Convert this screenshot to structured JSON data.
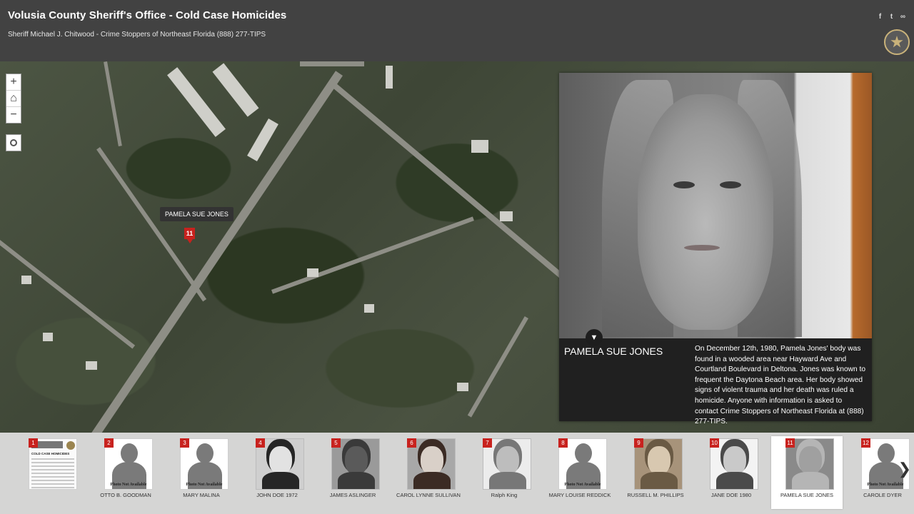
{
  "header": {
    "title": "Volusia County Sheriff's Office - Cold Case Homicides",
    "subtitle": "Sheriff Michael J. Chitwood - Crime Stoppers of Northeast Florida (888) 277-TIPS",
    "social": [
      "facebook-icon",
      "twitter-icon",
      "link-icon"
    ]
  },
  "map_controls": {
    "zoom_in": "+",
    "home": "⌂",
    "zoom_out": "−"
  },
  "marker": {
    "label": "PAMELA SUE JONES",
    "number": "11"
  },
  "detail": {
    "name": "PAMELA SUE JONES",
    "description": "On December 12th, 1980, Pamela Jones' body was found in a wooded area near Hayward Ave and Courtland Boulevard in Deltona. Jones was known to frequent the Daytona Beach area. Her body showed signs of violent trauma and her death was ruled a homicide. Anyone with information is asked to contact Crime Stoppers of Northeast Florida at (888) 277-TIPS.",
    "collapse_icon": "chevron-down-icon"
  },
  "carousel": {
    "photo_not_available": "Photo Not Available",
    "items": [
      {
        "num": "1",
        "name": "",
        "kind": "doc"
      },
      {
        "num": "2",
        "name": "OTTO B. GOODMAN",
        "kind": "silhouette"
      },
      {
        "num": "3",
        "name": "MARY MALINA",
        "kind": "silhouette"
      },
      {
        "num": "4",
        "name": "JOHN DOE 1972",
        "kind": "photo"
      },
      {
        "num": "5",
        "name": "JAMES ASLINGER",
        "kind": "photo"
      },
      {
        "num": "6",
        "name": "CAROL LYNNE SULLIVAN",
        "kind": "photo"
      },
      {
        "num": "7",
        "name": "Ralph King",
        "kind": "photo"
      },
      {
        "num": "8",
        "name": "MARY LOUISE REDDICK",
        "kind": "silhouette"
      },
      {
        "num": "9",
        "name": "RUSSELL M. PHILLIPS",
        "kind": "photo"
      },
      {
        "num": "10",
        "name": "JANE DOE 1980",
        "kind": "photo"
      },
      {
        "num": "11",
        "name": "PAMELA SUE JONES",
        "kind": "photo",
        "active": true
      },
      {
        "num": "12",
        "name": "CAROLE DYER",
        "kind": "silhouette"
      }
    ],
    "doc_thumb_title": "COLD CASE HOMICIDES",
    "next_icon": "chevron-right-icon"
  },
  "colors": {
    "header_bg": "#424242",
    "marker_red": "#c8221e",
    "panel_bg": "#202020"
  }
}
